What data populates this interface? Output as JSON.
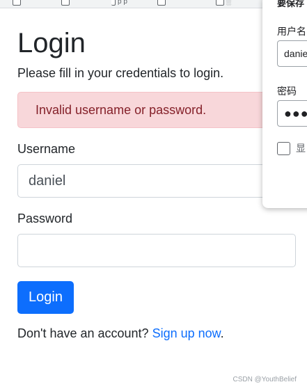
{
  "browser": {
    "tab_stub_text": "p p",
    "tab_stub_text_2": "░"
  },
  "login": {
    "title": "Login",
    "subtitle": "Please fill in your credentials to login.",
    "error_message": "Invalid username or password.",
    "username_label": "Username",
    "username_value": "daniel",
    "password_label": "Password",
    "password_value": "",
    "submit_label": "Login",
    "signup_prefix": "Don't have an account? ",
    "signup_link": "Sign up now",
    "signup_suffix": "."
  },
  "password_manager": {
    "title": "要保存",
    "username_label": "用户名",
    "username_value": "danie",
    "password_label": "密码",
    "password_value": "●●●●",
    "show_password_label": "显"
  },
  "watermark": "CSDN @YouthBelief",
  "colors": {
    "primary": "#0d6efd",
    "alert_bg": "#f8d7da",
    "alert_text": "#842029"
  }
}
